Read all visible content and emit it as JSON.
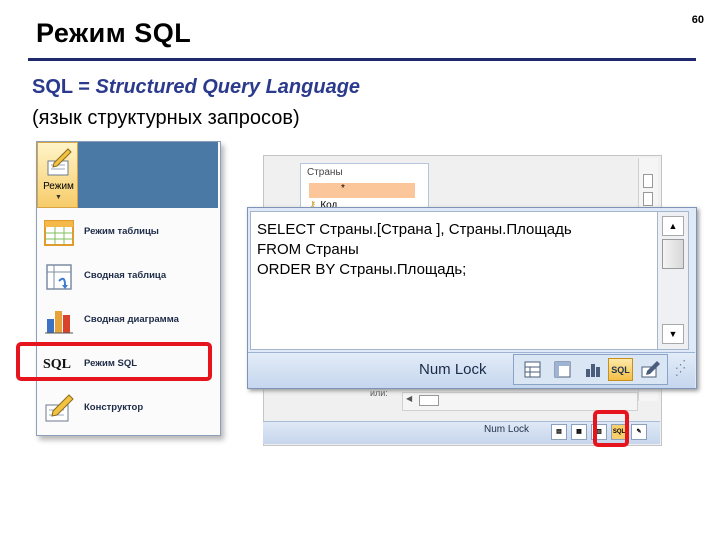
{
  "slide": {
    "title": "Режим SQL",
    "number": "60",
    "subtitle_prefix": "SQL = ",
    "subtitle_term": "Structured Query Language",
    "subtitle_ru": "(язык структурных запросов)"
  },
  "view_menu": {
    "button_label": "Режим",
    "items": [
      {
        "label": "Режим таблицы",
        "icon": "table-view-icon"
      },
      {
        "label": "Сводная таблица",
        "icon": "pivot-table-icon"
      },
      {
        "label": "Сводная диаграмма",
        "icon": "pivot-chart-icon"
      },
      {
        "label": "Режим SQL",
        "icon": "sql-view-icon",
        "icon_text": "SQL"
      },
      {
        "label": "Конструктор",
        "icon": "design-view-icon"
      }
    ]
  },
  "query_window": {
    "table_title": "Страны",
    "table_star": "*",
    "table_key_field": "Код",
    "criteria_label": "или:"
  },
  "sql_editor": {
    "lines": [
      "SELECT Страны.[Страна ], Страны.Площадь",
      "FROM Страны",
      "ORDER BY Страны.Площадь;"
    ]
  },
  "status_bar": {
    "num_lock": "Num Lock",
    "sql_button": "SQL"
  },
  "colors": {
    "title_rule": "#1f2a6e",
    "subtitle": "#2b3a8c",
    "highlight": "#e6141c",
    "ribbon": "#4a79a6"
  }
}
